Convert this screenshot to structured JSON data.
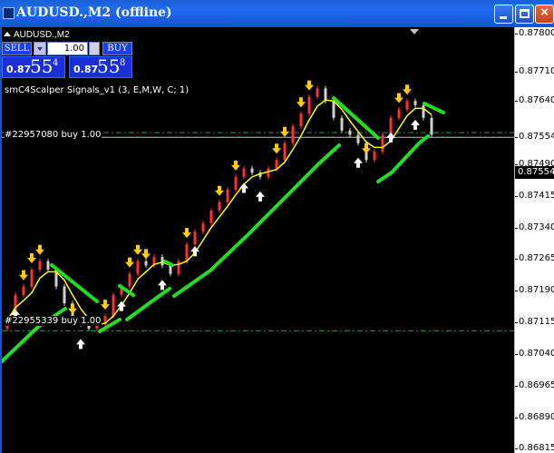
{
  "window": {
    "title": "AUDUSD.,M2 (offline)",
    "buttons": {
      "minimize": "minimize-icon",
      "maximize": "maximize-icon",
      "close": "×"
    }
  },
  "chart_header": {
    "symbol": "AUDUSD.,M2"
  },
  "one_click_trading": {
    "sell_label": "SELL",
    "buy_label": "BUY",
    "lot_value": "1.00",
    "sell_price": {
      "prefix": "0.87",
      "big": "55",
      "sup": "4"
    },
    "buy_price": {
      "prefix": "0.87",
      "big": "55",
      "sup": "8"
    }
  },
  "indicator_label": "smC4Scalper Signals_v1 (3, E,M,W, C; 1)",
  "orders": [
    {
      "label": "#22957080 buy 1.00",
      "price": 0.87565
    },
    {
      "label": "#22955339 buy 1.00",
      "price": 0.87095
    }
  ],
  "current_price_label": "0.87554",
  "chart_data": {
    "type": "candlestick",
    "symbol": "AUDUSD.",
    "timeframe": "M2",
    "ylim": [
      0.86805,
      0.87815
    ],
    "y_ticks": [
      "0.87800",
      "0.87710",
      "0.87640",
      "0.87554",
      "0.87490",
      "0.87415",
      "0.87340",
      "0.87265",
      "0.87190",
      "0.87115",
      "0.87040",
      "0.86965",
      "0.86890",
      "0.86815"
    ],
    "moving_average_color": "#ffff00",
    "trend_band_color": "#22dd22",
    "buy_arrow_color": "#ffffff",
    "sell_arrow_color": "#ffcc00",
    "order_line_color": "#2e8b57",
    "close_series": [
      0.8712,
      0.8718,
      0.872,
      0.8724,
      0.8726,
      0.8724,
      0.872,
      0.8716,
      0.8712,
      0.8711,
      0.871,
      0.8711,
      0.8713,
      0.8718,
      0.872,
      0.8723,
      0.8726,
      0.8725,
      0.8727,
      0.8725,
      0.8723,
      0.8726,
      0.873,
      0.8733,
      0.8735,
      0.8738,
      0.874,
      0.8743,
      0.8746,
      0.8748,
      0.8747,
      0.8746,
      0.8748,
      0.875,
      0.8754,
      0.8758,
      0.8761,
      0.8765,
      0.8767,
      0.8764,
      0.876,
      0.8757,
      0.8756,
      0.8754,
      0.875,
      0.8752,
      0.8756,
      0.876,
      0.8762,
      0.8764,
      0.8763,
      0.876,
      0.8756
    ]
  }
}
